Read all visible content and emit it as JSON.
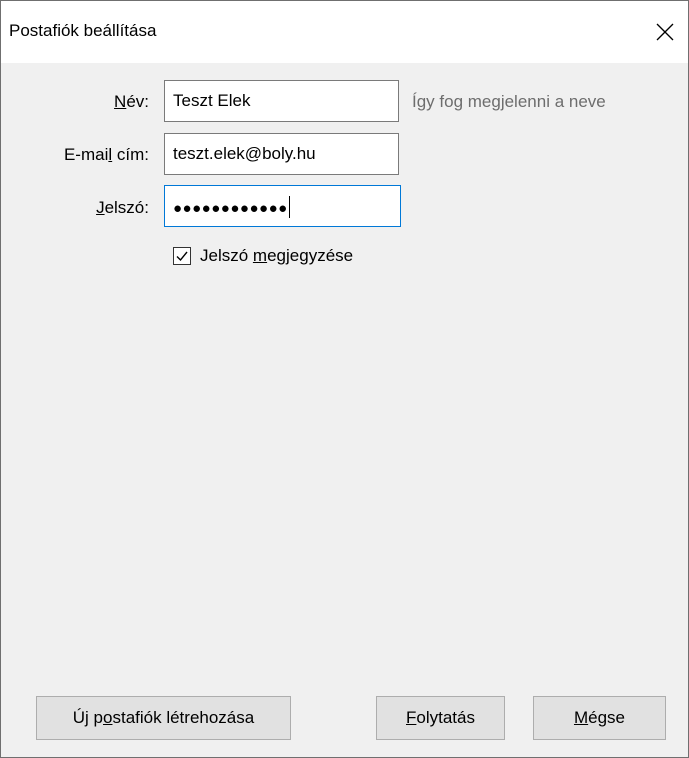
{
  "window": {
    "title": "Postafiók beállítása",
    "close_icon": "close-icon"
  },
  "form": {
    "name": {
      "label_prefix": "",
      "label_access": "N",
      "label_suffix": "év:",
      "value": "Teszt Elek",
      "hint": "Így fog megjelenni a neve"
    },
    "email": {
      "label_prefix": "E-mai",
      "label_access": "l",
      "label_suffix": " cím:",
      "value": "teszt.elek@boly.hu"
    },
    "password": {
      "label_prefix": "",
      "label_access": "J",
      "label_suffix": "elszó:",
      "masked_value": "●●●●●●●●●●●●"
    },
    "remember": {
      "checked": true,
      "label_prefix": "Jelszó ",
      "label_access": "m",
      "label_suffix": "egjegyzése"
    }
  },
  "buttons": {
    "new_account": {
      "prefix": "Új p",
      "access": "o",
      "suffix": "stafiók létrehozása"
    },
    "continue": {
      "prefix": "",
      "access": "F",
      "suffix": "olytatás"
    },
    "cancel": {
      "prefix": "",
      "access": "M",
      "suffix": "égse"
    }
  }
}
